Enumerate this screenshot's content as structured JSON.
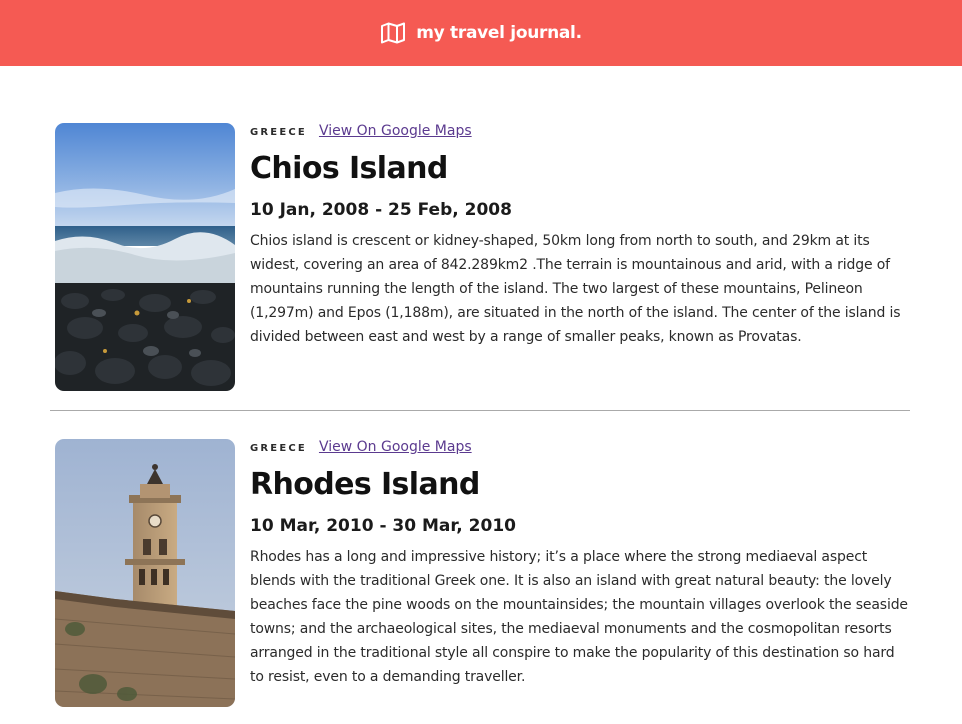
{
  "header": {
    "brand": "my travel journal.",
    "icon": "map-icon",
    "background": "#f55a53"
  },
  "entries": [
    {
      "country": "GREECE",
      "maps_link": "View On Google Maps",
      "title": "Chios Island",
      "dates": "10 Jan, 2008 - 25 Feb, 2008",
      "description": "Chios island is crescent or kidney-shaped, 50km long from north to south, and 29km at its widest, covering an area of 842.289km2 .The terrain is mountainous and arid, with a ridge of mountains running the length of the island. The two largest of these mountains, Pelineon (1,297m) and Epos (1,188m), are situated in the north of the island. The center of the island is divided between east and west by a range of smaller peaks, known as Provatas."
    },
    {
      "country": "GREECE",
      "maps_link": "View On Google Maps",
      "title": "Rhodes Island",
      "dates": "10 Mar, 2010 - 30 Mar, 2010",
      "description": "Rhodes has a long and impressive history; it’s a place where the strong mediaeval aspect blends with the traditional Greek one. It is also an island with great natural beauty: the lovely beaches face the pine woods on the mountainsides; the mountain villages overlook the seaside towns; and the archaeological sites, the mediaeval monuments and the cosmopolitan resorts arranged in the traditional style all conspire to make the popularity of this destination so hard to resist, even to a demanding traveller."
    }
  ]
}
